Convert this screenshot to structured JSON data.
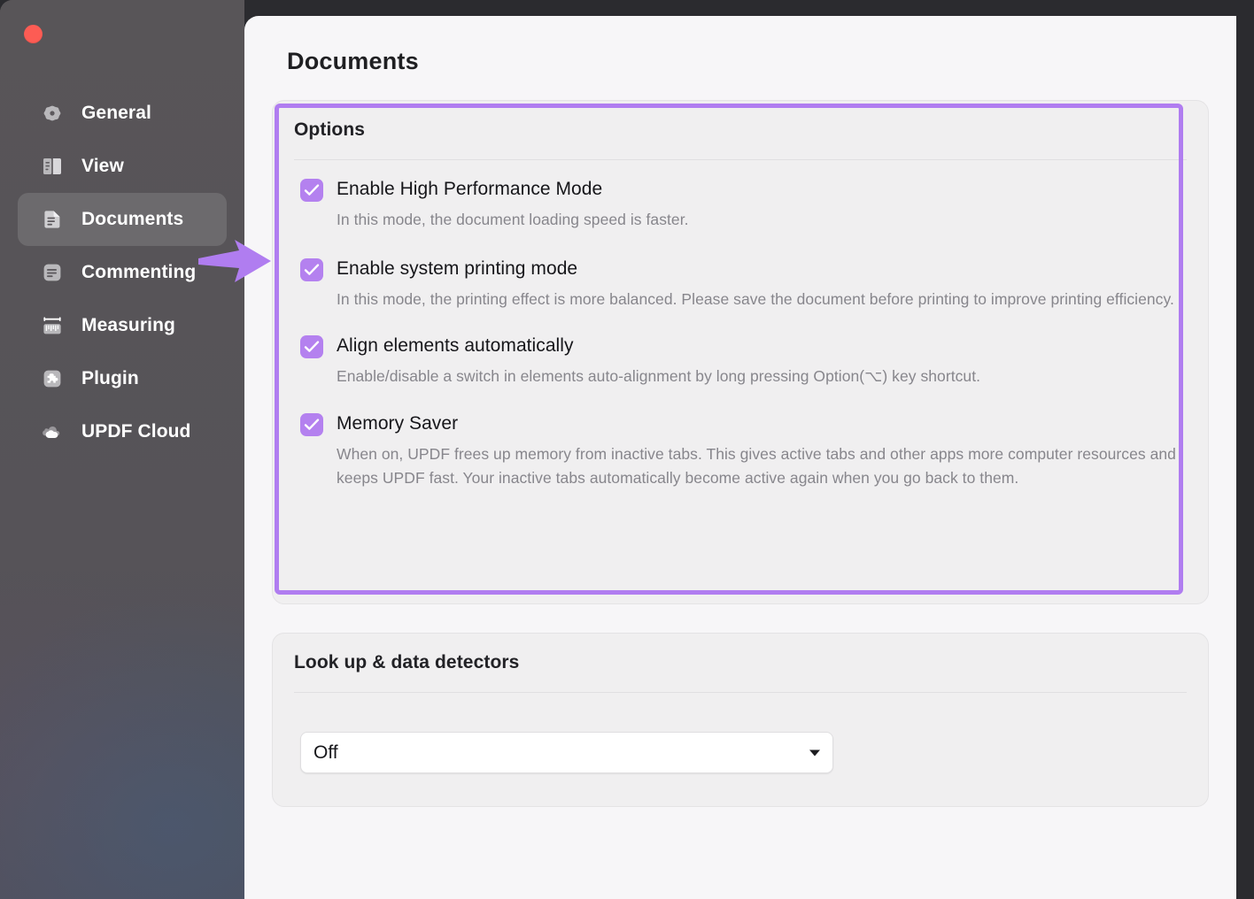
{
  "window": {
    "close_button": "close",
    "title": "Documents"
  },
  "sidebar": {
    "items": [
      {
        "id": "general",
        "label": "General",
        "icon": "gear-icon",
        "selected": false
      },
      {
        "id": "view",
        "label": "View",
        "icon": "book-icon",
        "selected": false
      },
      {
        "id": "documents",
        "label": "Documents",
        "icon": "document-icon",
        "selected": true
      },
      {
        "id": "commenting",
        "label": "Commenting",
        "icon": "comment-icon",
        "selected": false
      },
      {
        "id": "measuring",
        "label": "Measuring",
        "icon": "ruler-icon",
        "selected": false
      },
      {
        "id": "plugin",
        "label": "Plugin",
        "icon": "puzzle-icon",
        "selected": false
      },
      {
        "id": "updf-cloud",
        "label": "UPDF Cloud",
        "icon": "cloud-icon",
        "selected": false
      }
    ]
  },
  "main": {
    "page_title": "Documents",
    "options_card": {
      "title": "Options",
      "highlighted": true,
      "highlight_color": "#b07df0",
      "options": [
        {
          "label": "Enable High Performance Mode",
          "checked": true,
          "description": "In this mode, the document loading speed is faster."
        },
        {
          "label": "Enable system printing mode",
          "checked": true,
          "description": "In this mode, the printing effect is more balanced. Please save the document before printing to improve printing efficiency."
        },
        {
          "label": "Align elements automatically",
          "checked": true,
          "description": "Enable/disable a switch in elements auto-alignment by long pressing Option(⌥) key shortcut."
        },
        {
          "label": "Memory Saver",
          "checked": true,
          "description": "When on, UPDF frees up memory from inactive tabs. This gives active tabs and other apps more computer resources and keeps UPDF fast. Your inactive tabs automatically become active again when you go back to them."
        }
      ]
    },
    "lookup_card": {
      "title": "Look up & data detectors",
      "dropdown": {
        "value": "Off",
        "options": [
          "Off"
        ]
      }
    }
  },
  "annotation": {
    "arrow": "right-arrow-annotation",
    "color": "#b07df0",
    "points_at": "Documents"
  },
  "colors": {
    "accent_purple": "#b481ef",
    "highlight_purple": "#b07df0",
    "sidebar_bg": "#585558",
    "panel_bg": "#f7f6f8",
    "card_bg": "#f0eff0",
    "close_red": "#fd5c54"
  }
}
